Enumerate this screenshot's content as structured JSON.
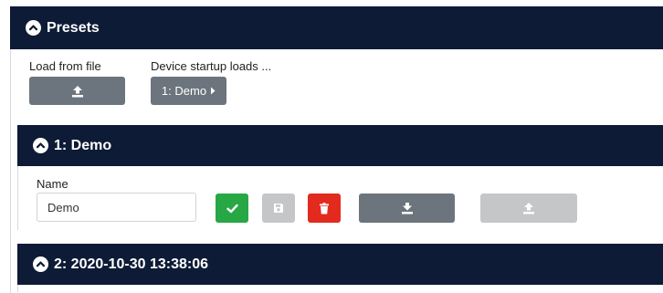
{
  "presets": {
    "title": "Presets",
    "load_from_file_label": "Load from file",
    "startup_label": "Device startup loads ...",
    "startup_value": "1: Demo",
    "icons": {
      "header": "chevron-up-circle-icon",
      "upload": "upload-icon",
      "startup_dropdown": "caret-right-icon"
    }
  },
  "preset_items": [
    {
      "title": "1: Demo",
      "name_label": "Name",
      "name_value": "Demo",
      "name_placeholder": "",
      "actions": [
        "check-icon",
        "save-icon",
        "trash-icon",
        "download-icon",
        "upload-icon"
      ]
    },
    {
      "title": "2: 2020-10-30 13:38:06"
    }
  ],
  "colors": {
    "header_bg": "#0d1b36",
    "grey_button": "#6c757d",
    "disabled_button": "#c4c6c8",
    "confirm_green": "#28a745",
    "delete_red": "#e32a1e"
  }
}
